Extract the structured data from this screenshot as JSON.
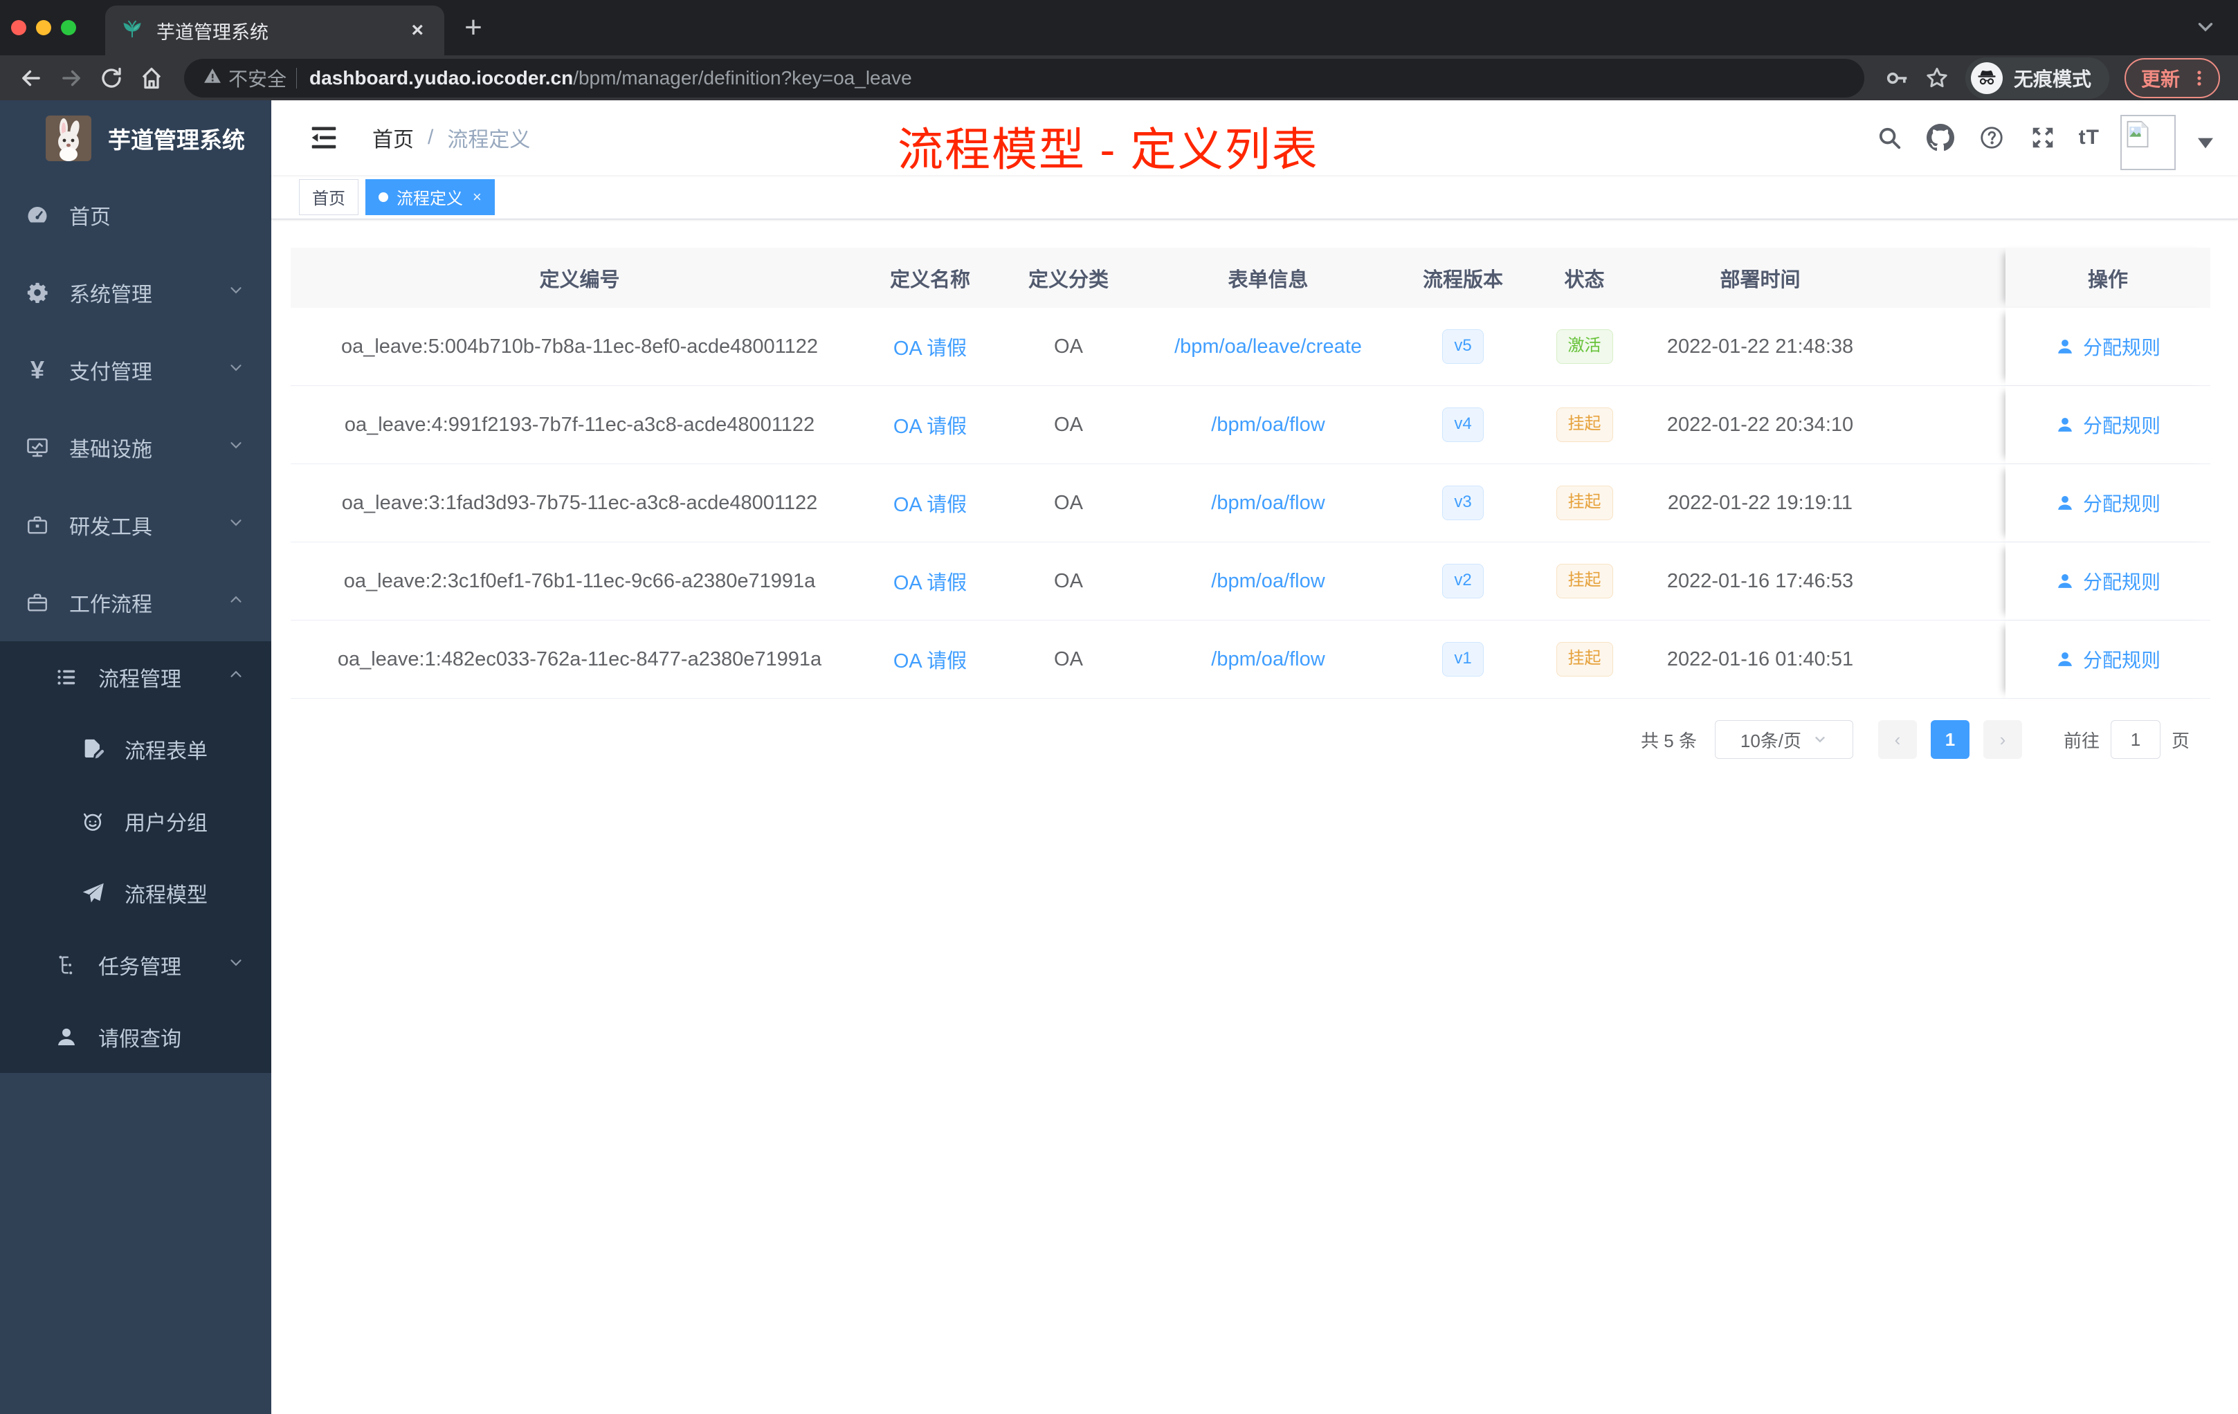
{
  "colors": {
    "accent": "#409eff",
    "success": "#67c23a",
    "warning": "#e6a23c",
    "annotation_red": "#ff2600",
    "sidebar_bg": "#304156",
    "submenu_bg": "#1f2d3d"
  },
  "browser": {
    "tab_title": "芋道管理系统",
    "tab_close": "×",
    "new_tab": "+",
    "security_label": "不安全",
    "url_host": "dashboard.yudao.iocoder.cn",
    "url_path": "/bpm/manager/definition?key=oa_leave",
    "incognito_label": "无痕模式",
    "update_label": "更新"
  },
  "sidebar": {
    "logo_title": "芋道管理系统",
    "items": [
      {
        "label": "首页",
        "icon": "dashboard-icon",
        "level": 1,
        "chevron": null,
        "sub": false
      },
      {
        "label": "系统管理",
        "icon": "gear-icon",
        "level": 1,
        "chevron": "down",
        "sub": false
      },
      {
        "label": "支付管理",
        "icon": "yen-icon",
        "level": 1,
        "chevron": "down",
        "sub": false
      },
      {
        "label": "基础设施",
        "icon": "monitor-icon",
        "level": 1,
        "chevron": "down",
        "sub": false
      },
      {
        "label": "研发工具",
        "icon": "toolbox-icon",
        "level": 1,
        "chevron": "down",
        "sub": false
      },
      {
        "label": "工作流程",
        "icon": "briefcase-icon",
        "level": 1,
        "chevron": "up",
        "sub": false
      },
      {
        "label": "流程管理",
        "icon": "list-icon",
        "level": 2,
        "chevron": "up",
        "sub": true
      },
      {
        "label": "流程表单",
        "icon": "form-edit-icon",
        "level": 3,
        "chevron": null,
        "sub": true
      },
      {
        "label": "用户分组",
        "icon": "face-icon",
        "level": 3,
        "chevron": null,
        "sub": true
      },
      {
        "label": "流程模型",
        "icon": "paper-plane-icon",
        "level": 3,
        "chevron": null,
        "sub": true
      },
      {
        "label": "任务管理",
        "icon": "tree-icon",
        "level": 2,
        "chevron": "down",
        "sub": true
      },
      {
        "label": "请假查询",
        "icon": "user-icon",
        "level": 2,
        "chevron": null,
        "sub": true
      }
    ]
  },
  "navbar": {
    "breadcrumb": {
      "home": "首页",
      "separator": "/",
      "current": "流程定义"
    },
    "right_icons": [
      "search-icon",
      "github-icon",
      "question-icon",
      "fullscreen-icon",
      "font-size-icon"
    ],
    "font_size_glyph": "tT"
  },
  "annotation": {
    "text": "流程模型 - 定义列表"
  },
  "tags": {
    "home": {
      "label": "首页"
    },
    "active": {
      "label": "流程定义",
      "close": "×"
    }
  },
  "table": {
    "columns": [
      "定义编号",
      "定义名称",
      "定义分类",
      "表单信息",
      "流程版本",
      "状态",
      "部署时间",
      "操作"
    ],
    "rows": [
      {
        "id": "oa_leave:5:004b710b-7b8a-11ec-8ef0-acde48001122",
        "name": "OA 请假",
        "category": "OA",
        "form": "/bpm/oa/leave/create",
        "version": "v5",
        "status": "激活",
        "status_type": "success",
        "time": "2022-01-22 21:48:38",
        "action": "分配规则"
      },
      {
        "id": "oa_leave:4:991f2193-7b7f-11ec-a3c8-acde48001122",
        "name": "OA 请假",
        "category": "OA",
        "form": "/bpm/oa/flow",
        "version": "v4",
        "status": "挂起",
        "status_type": "warning",
        "time": "2022-01-22 20:34:10",
        "action": "分配规则"
      },
      {
        "id": "oa_leave:3:1fad3d93-7b75-11ec-a3c8-acde48001122",
        "name": "OA 请假",
        "category": "OA",
        "form": "/bpm/oa/flow",
        "version": "v3",
        "status": "挂起",
        "status_type": "warning",
        "time": "2022-01-22 19:19:11",
        "action": "分配规则"
      },
      {
        "id": "oa_leave:2:3c1f0ef1-76b1-11ec-9c66-a2380e71991a",
        "name": "OA 请假",
        "category": "OA",
        "form": "/bpm/oa/flow",
        "version": "v2",
        "status": "挂起",
        "status_type": "warning",
        "time": "2022-01-16 17:46:53",
        "action": "分配规则"
      },
      {
        "id": "oa_leave:1:482ec033-762a-11ec-8477-a2380e71991a",
        "name": "OA 请假",
        "category": "OA",
        "form": "/bpm/oa/flow",
        "version": "v1",
        "status": "挂起",
        "status_type": "warning",
        "time": "2022-01-16 01:40:51",
        "action": "分配规则"
      }
    ]
  },
  "pagination": {
    "total": "共 5 条",
    "page_size": "10条/页",
    "prev": "‹",
    "current_page": "1",
    "next": "›",
    "goto_label": "前往",
    "goto_value": "1",
    "page_unit": "页"
  }
}
